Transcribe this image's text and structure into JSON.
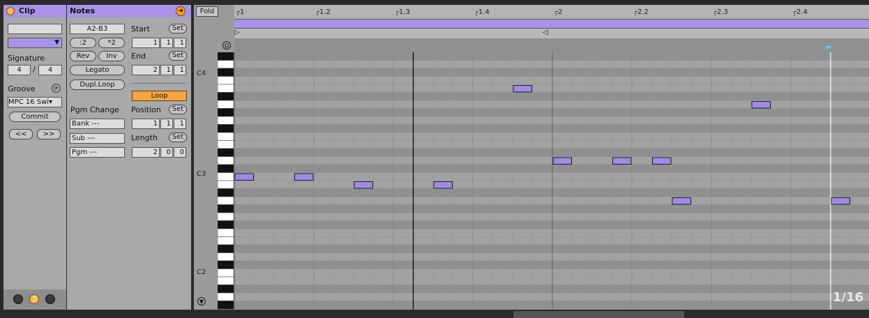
{
  "clip": {
    "title": "Clip",
    "signature_label": "Signature",
    "sig_num": "4",
    "sig_sep": "/",
    "sig_den": "4",
    "groove_label": "Groove",
    "groove_value": "MPC 16 Swi▾",
    "commit": "Commit",
    "prev": "<<",
    "next": ">>",
    "color": "#a993e8"
  },
  "notes": {
    "title": "Notes",
    "range": "A2-B3",
    "half": ":2",
    "double": "*2",
    "rev": "Rev",
    "inv": "Inv",
    "legato": "Legato",
    "dupl": "Dupl.Loop",
    "pgm_change": "Pgm Change",
    "bank": "Bank ---",
    "sub": "Sub ---",
    "pgm": "Pgm ---"
  },
  "markers": {
    "start_label": "Start",
    "set": "Set",
    "start": [
      "1",
      "1",
      "1"
    ],
    "end_label": "End",
    "end": [
      "2",
      "1",
      "1"
    ],
    "loop": "Loop",
    "position_label": "Position",
    "position": [
      "1",
      "1",
      "1"
    ],
    "length_label": "Length",
    "length": [
      "2",
      "0",
      "0"
    ]
  },
  "roll": {
    "fold": "Fold",
    "ruler": [
      "1",
      "1.2",
      "1.3",
      "1.4",
      "2",
      "2.2",
      "2.3",
      "2.4"
    ],
    "key_labels": [
      "C4",
      "C3",
      "C2"
    ],
    "grid": "1/16",
    "accent": "#ff9a1f",
    "note_color": "#9f8ae3",
    "notes": [
      {
        "pitch": "C3",
        "beat": 0.0,
        "length": 0.25
      },
      {
        "pitch": "C3",
        "beat": 0.75,
        "length": 0.25
      },
      {
        "pitch": "B2",
        "beat": 1.5,
        "length": 0.25
      },
      {
        "pitch": "B2",
        "beat": 2.5,
        "length": 0.25
      },
      {
        "pitch": "B3",
        "beat": 3.5,
        "length": 0.25
      },
      {
        "pitch": "D3",
        "beat": 4.0,
        "length": 0.25
      },
      {
        "pitch": "D3",
        "beat": 4.75,
        "length": 0.25
      },
      {
        "pitch": "D3",
        "beat": 5.25,
        "length": 0.25
      },
      {
        "pitch": "A2",
        "beat": 5.5,
        "length": 0.25
      },
      {
        "pitch": "A3",
        "beat": 6.5,
        "length": 0.25
      },
      {
        "pitch": "A2",
        "beat": 7.5,
        "length": 0.25
      }
    ]
  }
}
